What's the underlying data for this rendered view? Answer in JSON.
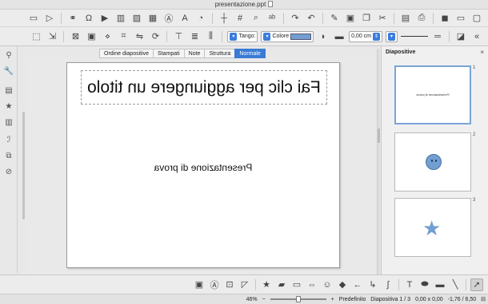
{
  "window": {
    "title": "presentazione.ppt"
  },
  "toolbar1": {
    "icons": [
      "new-icon",
      "open-icon",
      "save-icon",
      "export-pdf-icon",
      "print-icon",
      "cut-icon",
      "copy-icon",
      "paste-icon",
      "clone-icon",
      "undo-icon",
      "redo-icon",
      "spelling-icon",
      "find-icon",
      "display-grid-icon",
      "helplines-icon",
      "zoom-icon",
      "text-icon",
      "fontwork-icon",
      "table-icon",
      "image-icon",
      "chart-icon",
      "media-icon",
      "special-char-icon",
      "hyperlink-icon",
      "start-slideshow-icon",
      "slide-icon"
    ]
  },
  "toolbar2": {
    "line_width_value": "0,00 cm",
    "area_style_value": "Colore",
    "area_fill_value": "Tango:",
    "fill_color": "#729fcf",
    "accent_color": "#3a7bd5"
  },
  "tabs": [
    "Normale",
    "Struttura",
    "Note",
    "Stampati",
    "Ordine diapositive"
  ],
  "active_tab": "Normale",
  "slide": {
    "title_placeholder": "Fai clic per aggiungere un titolo",
    "subtitle": "Presentazione di prova"
  },
  "panel": {
    "title": "Diapositive",
    "close_label": "×",
    "thumbnails": [
      {
        "number": "1",
        "text": "Presentazione di prova",
        "selected": true
      },
      {
        "number": "2",
        "shape": "smiley-icon"
      },
      {
        "number": "3",
        "shape": "star-icon"
      }
    ]
  },
  "status": {
    "position": "-1,76 / 6,50",
    "size": "0,00 x 0,00",
    "slide_info": "Diapositiva 1 / 3",
    "layout": "Predefinito",
    "zoom_value": "46%"
  }
}
